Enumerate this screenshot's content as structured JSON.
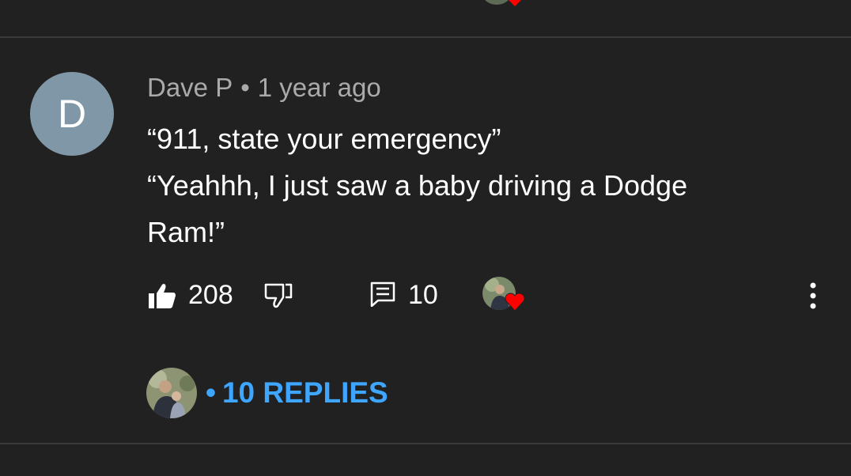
{
  "comment": {
    "author_initial": "D",
    "author": "Dave P",
    "separator": "•",
    "time": "1 year ago",
    "lines": [
      "“911, state your emergency”",
      "“Yeahhh, I just saw a baby driving a Dodge",
      "Ram!”"
    ],
    "like_count": "208",
    "reply_count": "10",
    "replies_label": "10 REPLIES",
    "replies_dot": "•"
  },
  "colors": {
    "background": "#212121",
    "divider": "#3a3a3a",
    "meta_text": "#aaaaaa",
    "link": "#3ea6ff",
    "author_avatar": "#7f97a7",
    "heart": "#ff0000"
  },
  "icons": {
    "like": "thumbs-up-icon",
    "dislike": "thumbs-down-icon",
    "reply": "comment-icon",
    "hearted": "heart-icon",
    "more": "more-vertical-icon"
  }
}
